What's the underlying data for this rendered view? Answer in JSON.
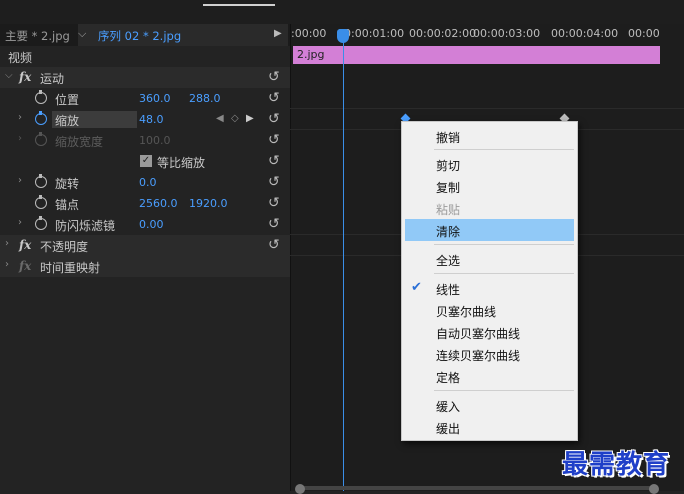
{
  "sequence_bar": {
    "master_label": "主要 * 2.jpg",
    "sequence_label": "序列 02 * 2.jpg"
  },
  "effects": {
    "video_header": "视频",
    "motion": {
      "label": "运动"
    },
    "position": {
      "label": "位置",
      "x": "360.0",
      "y": "288.0"
    },
    "scale": {
      "label": "缩放",
      "value": "48.0"
    },
    "scale_width": {
      "label": "缩放宽度",
      "value": "100.0"
    },
    "uniform_scale": {
      "label": "等比缩放",
      "checked": true
    },
    "rotation": {
      "label": "旋转",
      "value": "0.0"
    },
    "anchor": {
      "label": "锚点",
      "x": "2560.0",
      "y": "1920.0"
    },
    "antiflicker": {
      "label": "防闪烁滤镜",
      "value": "0.00"
    },
    "opacity": {
      "label": "不透明度"
    },
    "time_remap": {
      "label": "时间重映射"
    }
  },
  "timeline": {
    "ruler_ticks": [
      ":00:00",
      "00:00:01:00",
      "00:00:02:00",
      "00:00:03:00",
      "00:00:04:00",
      "00:00"
    ],
    "clip_label": "2.jpg",
    "accent": "#3a8ee8",
    "clip_color": "#d37fd6"
  },
  "context_menu": {
    "items": [
      {
        "label": "撤销"
      },
      {
        "label": "剪切"
      },
      {
        "label": "复制"
      },
      {
        "label": "粘贴",
        "disabled": true
      },
      {
        "label": "清除",
        "highlighted": true
      },
      {
        "label": "全选"
      },
      {
        "label": "线性",
        "checked": true
      },
      {
        "label": "贝塞尔曲线"
      },
      {
        "label": "自动贝塞尔曲线"
      },
      {
        "label": "连续贝塞尔曲线"
      },
      {
        "label": "定格"
      },
      {
        "label": "缓入"
      },
      {
        "label": "缓出"
      }
    ],
    "highlight_color": "#91c9f7"
  },
  "watermark": "最需教育"
}
